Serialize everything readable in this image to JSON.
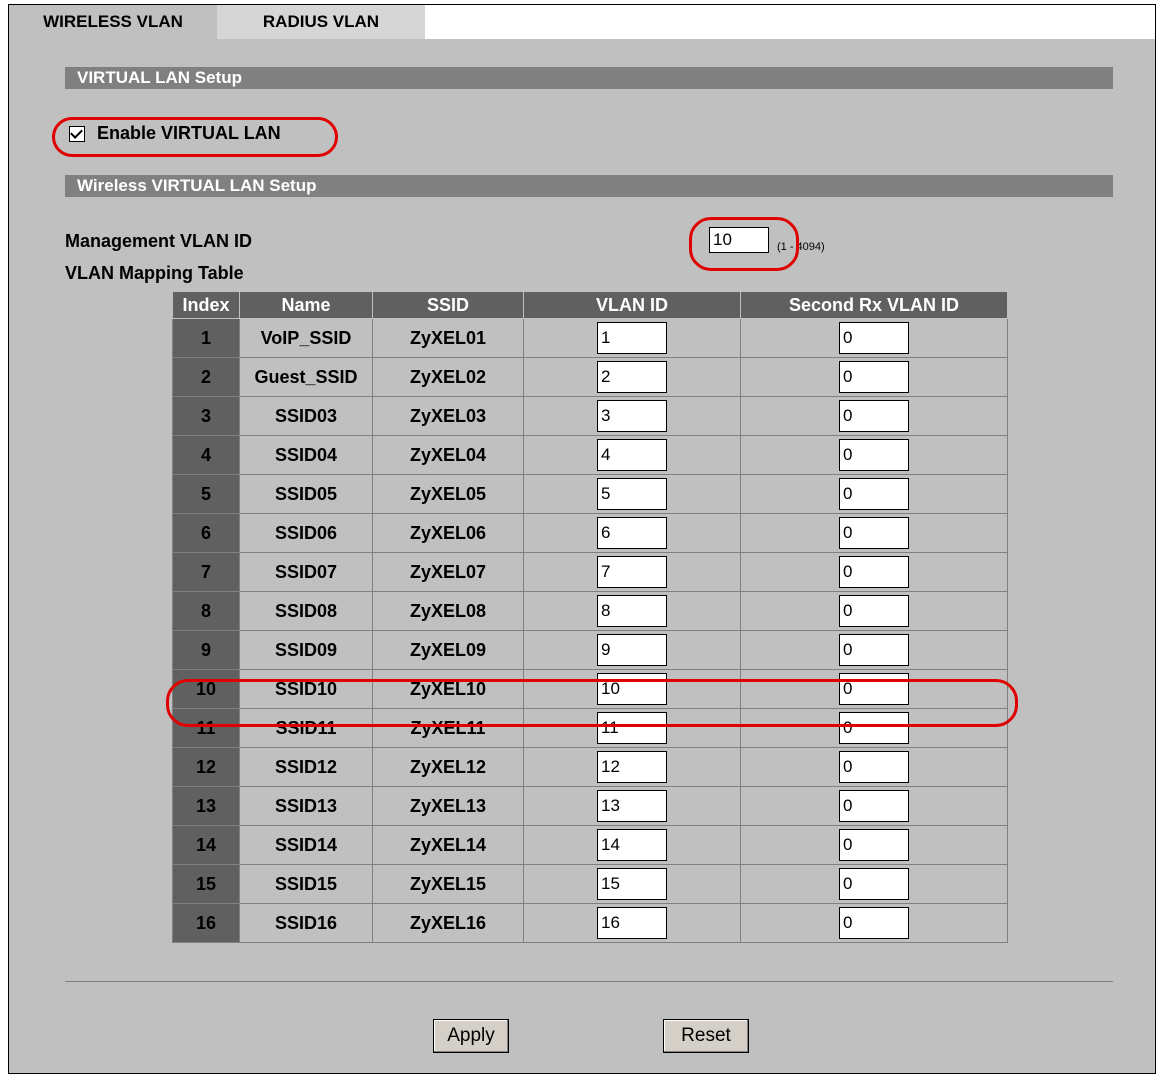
{
  "tabs": [
    {
      "label": "WIRELESS VLAN",
      "active": true
    },
    {
      "label": "RADIUS VLAN",
      "active": false
    }
  ],
  "sections": {
    "vlan_setup": "VIRTUAL LAN Setup",
    "wireless_setup": "Wireless VIRTUAL LAN Setup"
  },
  "enable_vlan": {
    "label": "Enable VIRTUAL LAN",
    "checked": true
  },
  "management": {
    "label": "Management VLAN ID",
    "value": "10",
    "range": "(1 - 4094)"
  },
  "mapping_table": {
    "title": "VLAN Mapping Table",
    "columns": [
      "Index",
      "Name",
      "SSID",
      "VLAN ID",
      "Second Rx VLAN ID"
    ],
    "rows": [
      {
        "index": "1",
        "name": "VoIP_SSID",
        "ssid": "ZyXEL01",
        "vlan_id": "1",
        "second_rx": "0"
      },
      {
        "index": "2",
        "name": "Guest_SSID",
        "ssid": "ZyXEL02",
        "vlan_id": "2",
        "second_rx": "0"
      },
      {
        "index": "3",
        "name": "SSID03",
        "ssid": "ZyXEL03",
        "vlan_id": "3",
        "second_rx": "0"
      },
      {
        "index": "4",
        "name": "SSID04",
        "ssid": "ZyXEL04",
        "vlan_id": "4",
        "second_rx": "0"
      },
      {
        "index": "5",
        "name": "SSID05",
        "ssid": "ZyXEL05",
        "vlan_id": "5",
        "second_rx": "0"
      },
      {
        "index": "6",
        "name": "SSID06",
        "ssid": "ZyXEL06",
        "vlan_id": "6",
        "second_rx": "0"
      },
      {
        "index": "7",
        "name": "SSID07",
        "ssid": "ZyXEL07",
        "vlan_id": "7",
        "second_rx": "0"
      },
      {
        "index": "8",
        "name": "SSID08",
        "ssid": "ZyXEL08",
        "vlan_id": "8",
        "second_rx": "0"
      },
      {
        "index": "9",
        "name": "SSID09",
        "ssid": "ZyXEL09",
        "vlan_id": "9",
        "second_rx": "0"
      },
      {
        "index": "10",
        "name": "SSID10",
        "ssid": "ZyXEL10",
        "vlan_id": "10",
        "second_rx": "0"
      },
      {
        "index": "11",
        "name": "SSID11",
        "ssid": "ZyXEL11",
        "vlan_id": "11",
        "second_rx": "0"
      },
      {
        "index": "12",
        "name": "SSID12",
        "ssid": "ZyXEL12",
        "vlan_id": "12",
        "second_rx": "0"
      },
      {
        "index": "13",
        "name": "SSID13",
        "ssid": "ZyXEL13",
        "vlan_id": "13",
        "second_rx": "0"
      },
      {
        "index": "14",
        "name": "SSID14",
        "ssid": "ZyXEL14",
        "vlan_id": "14",
        "second_rx": "0"
      },
      {
        "index": "15",
        "name": "SSID15",
        "ssid": "ZyXEL15",
        "vlan_id": "15",
        "second_rx": "0"
      },
      {
        "index": "16",
        "name": "SSID16",
        "ssid": "ZyXEL16",
        "vlan_id": "16",
        "second_rx": "0"
      }
    ]
  },
  "buttons": {
    "apply": "Apply",
    "reset": "Reset"
  },
  "colors": {
    "highlight_ring": "#e00000",
    "section_bar": "#808080",
    "header_bg": "#606060",
    "panel_bg": "#c0c0c0"
  }
}
